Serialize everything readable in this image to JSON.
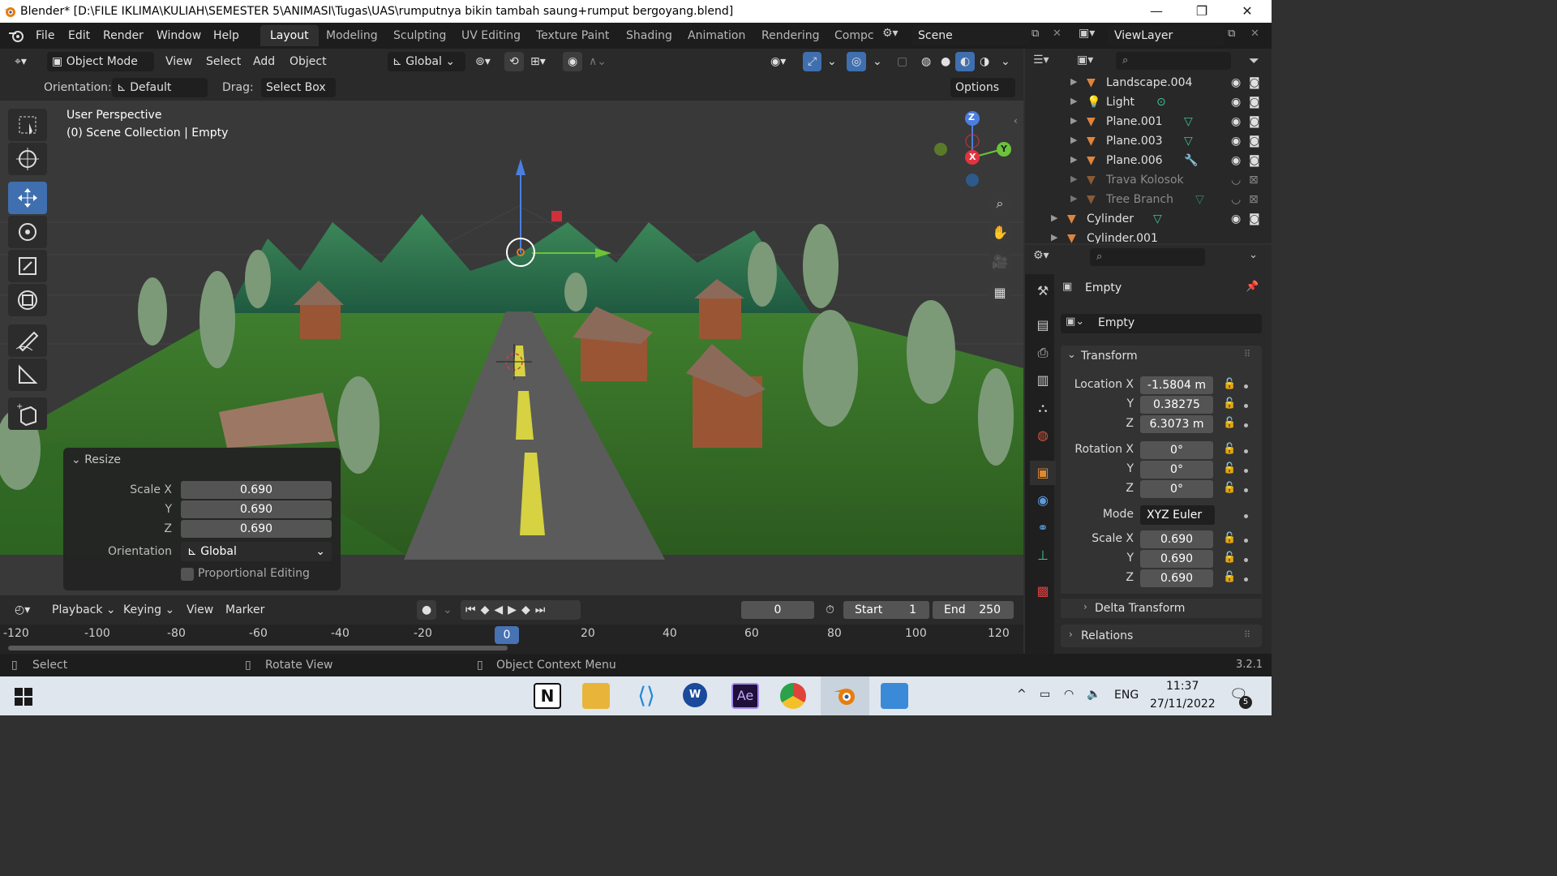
{
  "window": {
    "title": "Blender* [D:\\FILE IKLIMA\\KULIAH\\SEMESTER 5\\ANIMASI\\Tugas\\UAS\\rumputnya bikin tambah saung+rumput bergoyang.blend]",
    "minimize": "—",
    "restore": "❐",
    "close": "✕"
  },
  "menu": {
    "file": "File",
    "edit": "Edit",
    "render": "Render",
    "window": "Window",
    "help": "Help"
  },
  "workspaces": [
    "Layout",
    "Modeling",
    "Sculpting",
    "UV Editing",
    "Texture Paint",
    "Shading",
    "Animation",
    "Rendering",
    "Compc"
  ],
  "scene": {
    "name": "Scene",
    "view_layer": "ViewLayer"
  },
  "viewport_header": {
    "mode": "Object Mode",
    "view": "View",
    "select": "Select",
    "add": "Add",
    "object": "Object",
    "transform_orientation": "Global",
    "orientation_label": "Orientation:",
    "orientation_value": "Default",
    "drag_label": "Drag:",
    "drag_value": "Select Box",
    "options": "Options"
  },
  "viewport": {
    "perspective": "User Perspective",
    "collection": "(0) Scene Collection | Empty",
    "gizmo": {
      "z": "Z",
      "y": "Y",
      "x": "X"
    }
  },
  "resize_panel": {
    "title": "Resize",
    "scale_x_label": "Scale X",
    "scale_x": "0.690",
    "y_label": "Y",
    "scale_y": "0.690",
    "z_label": "Z",
    "scale_z": "0.690",
    "orientation_label": "Orientation",
    "orientation": "Global",
    "proportional": "Proportional Editing"
  },
  "timeline": {
    "playback": "Playback",
    "keying": "Keying",
    "view": "View",
    "marker": "Marker",
    "current_frame": "0",
    "start_label": "Start",
    "start": "1",
    "end_label": "End",
    "end": "250",
    "ticks": [
      "-120",
      "-100",
      "-80",
      "-60",
      "-40",
      "-20",
      "0",
      "20",
      "40",
      "60",
      "80",
      "100",
      "120"
    ]
  },
  "outliner": {
    "items": [
      {
        "name": "Landscape.004",
        "type": "mesh",
        "dim": false
      },
      {
        "name": "Light",
        "type": "light",
        "dim": false
      },
      {
        "name": "Plane.001",
        "type": "mesh",
        "dim": false
      },
      {
        "name": "Plane.003",
        "type": "mesh",
        "dim": false
      },
      {
        "name": "Plane.006",
        "type": "mesh",
        "dim": false
      },
      {
        "name": "Trava Kolosok",
        "type": "mesh",
        "dim": true
      },
      {
        "name": "Tree Branch",
        "type": "mesh",
        "dim": true
      },
      {
        "name": "Cylinder",
        "type": "mesh",
        "dim": false
      },
      {
        "name": "Cylinder.001",
        "type": "mesh",
        "dim": false
      }
    ]
  },
  "properties": {
    "object_name": "Empty",
    "object_field": "Empty",
    "transform_title": "Transform",
    "location_x_label": "Location X",
    "location_x": "-1.5804 m",
    "location_y_label": "Y",
    "location_y": "0.38275",
    "location_z_label": "Z",
    "location_z": "6.3073 m",
    "rotation_x_label": "Rotation X",
    "rotation_x": "0°",
    "rotation_y_label": "Y",
    "rotation_y": "0°",
    "rotation_z_label": "Z",
    "rotation_z": "0°",
    "mode_label": "Mode",
    "mode": "XYZ Euler",
    "scale_x_label": "Scale X",
    "scale_x": "0.690",
    "scale_y_label": "Y",
    "scale_y": "0.690",
    "scale_z_label": "Z",
    "scale_z": "0.690",
    "delta_transform": "Delta Transform",
    "relations": "Relations"
  },
  "statusbar": {
    "select": "Select",
    "rotate": "Rotate View",
    "context": "Object Context Menu",
    "version": "3.2.1"
  },
  "taskbar": {
    "time": "11:37",
    "date": "27/11/2022",
    "lang": "ENG",
    "notif_count": "5"
  },
  "colors": {
    "accent": "#4772b3",
    "mesh_icon": "#e0843c",
    "grass": "#3c7a2a",
    "road": "#5a5a5a",
    "stripe": "#d6d241"
  }
}
